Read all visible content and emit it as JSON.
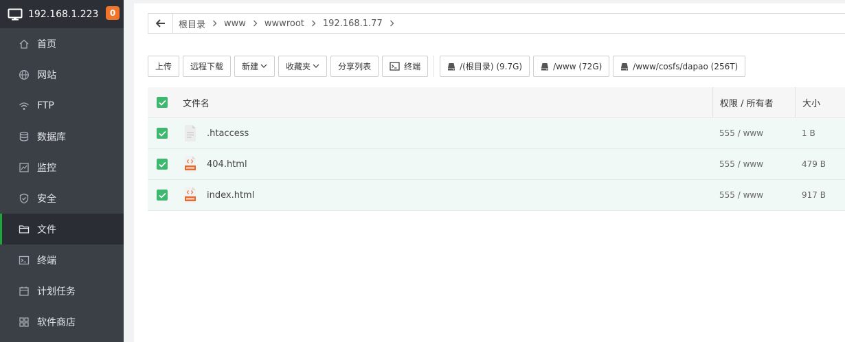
{
  "sidebar": {
    "host": "192.168.1.223",
    "badge": "0",
    "items": [
      {
        "label": "首页",
        "icon": "home-icon"
      },
      {
        "label": "网站",
        "icon": "globe-icon"
      },
      {
        "label": "FTP",
        "icon": "ftp-icon"
      },
      {
        "label": "数据库",
        "icon": "database-icon"
      },
      {
        "label": "监控",
        "icon": "monitor-chart-icon"
      },
      {
        "label": "安全",
        "icon": "shield-icon"
      },
      {
        "label": "文件",
        "icon": "folder-icon",
        "active": true
      },
      {
        "label": "终端",
        "icon": "terminal-icon"
      },
      {
        "label": "计划任务",
        "icon": "calendar-icon"
      },
      {
        "label": "软件商店",
        "icon": "grid-icon"
      }
    ]
  },
  "breadcrumb": [
    "根目录",
    "www",
    "wwwroot",
    "192.168.1.77"
  ],
  "toolbar": {
    "upload": "上传",
    "remote_download": "远程下载",
    "new": "新建",
    "favorites": "收藏夹",
    "share_list": "分享列表",
    "terminal": "终端",
    "disks": [
      "/(根目录) (9.7G)",
      "/www (72G)",
      "/www/cosfs/dapao (256T)"
    ]
  },
  "table": {
    "headers": {
      "name": "文件名",
      "perm": "权限 / 所有者",
      "size": "大小"
    },
    "rows": [
      {
        "name": ".htaccess",
        "perm": "555 / www",
        "size": "1 B",
        "type": "text-file-icon"
      },
      {
        "name": "404.html",
        "perm": "555 / www",
        "size": "479 B",
        "type": "html-file-icon"
      },
      {
        "name": "index.html",
        "perm": "555 / www",
        "size": "917 B",
        "type": "html-file-icon"
      }
    ]
  },
  "colors": {
    "accent": "#20a53a",
    "checkbox": "#3eb86e",
    "sidebar": "#3b4047",
    "badge": "#f0742a"
  }
}
